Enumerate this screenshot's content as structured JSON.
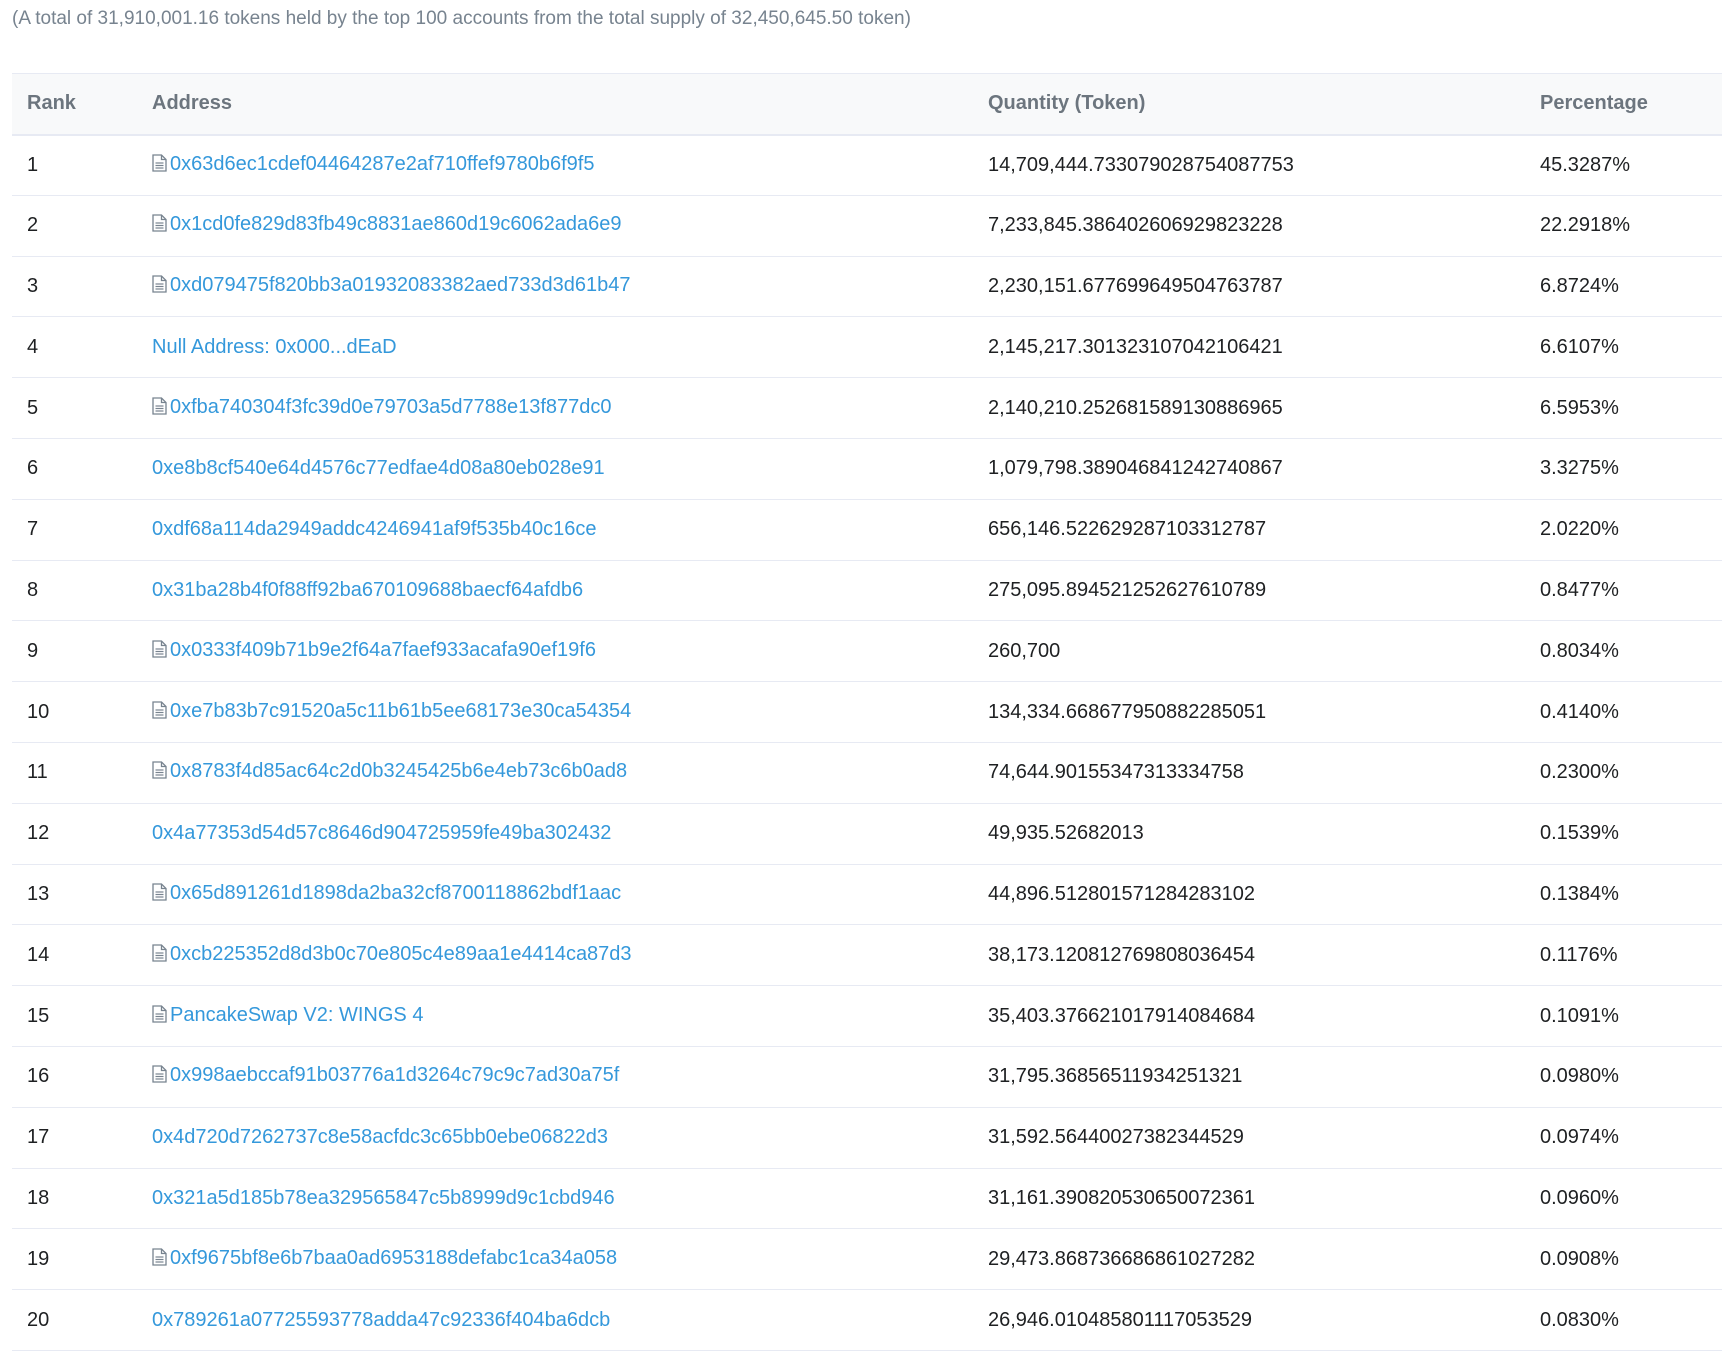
{
  "summary": "(A total of 31,910,001.16 tokens held by the top 100 accounts from the total supply of 32,450,645.50 token)",
  "columns": {
    "rank": "Rank",
    "address": "Address",
    "quantity": "Quantity (Token)",
    "percentage": "Percentage"
  },
  "rows": [
    {
      "rank": "1",
      "address": "0x63d6ec1cdef04464287e2af710ffef9780b6f9f5",
      "contract": true,
      "quantity": "14,709,444.733079028754087753",
      "percentage": "45.3287%"
    },
    {
      "rank": "2",
      "address": "0x1cd0fe829d83fb49c8831ae860d19c6062ada6e9",
      "contract": true,
      "quantity": "7,233,845.386402606929823228",
      "percentage": "22.2918%"
    },
    {
      "rank": "3",
      "address": "0xd079475f820bb3a01932083382aed733d3d61b47",
      "contract": true,
      "quantity": "2,230,151.677699649504763787",
      "percentage": "6.8724%"
    },
    {
      "rank": "4",
      "address": "Null Address: 0x000...dEaD",
      "contract": false,
      "quantity": "2,145,217.301323107042106421",
      "percentage": "6.6107%"
    },
    {
      "rank": "5",
      "address": "0xfba740304f3fc39d0e79703a5d7788e13f877dc0",
      "contract": true,
      "quantity": "2,140,210.252681589130886965",
      "percentage": "6.5953%"
    },
    {
      "rank": "6",
      "address": "0xe8b8cf540e64d4576c77edfae4d08a80eb028e91",
      "contract": false,
      "quantity": "1,079,798.389046841242740867",
      "percentage": "3.3275%"
    },
    {
      "rank": "7",
      "address": "0xdf68a114da2949addc4246941af9f535b40c16ce",
      "contract": false,
      "quantity": "656,146.522629287103312787",
      "percentage": "2.0220%"
    },
    {
      "rank": "8",
      "address": "0x31ba28b4f0f88ff92ba670109688baecf64afdb6",
      "contract": false,
      "quantity": "275,095.894521252627610789",
      "percentage": "0.8477%"
    },
    {
      "rank": "9",
      "address": "0x0333f409b71b9e2f64a7faef933acafa90ef19f6",
      "contract": true,
      "quantity": "260,700",
      "percentage": "0.8034%"
    },
    {
      "rank": "10",
      "address": "0xe7b83b7c91520a5c11b61b5ee68173e30ca54354",
      "contract": true,
      "quantity": "134,334.668677950882285051",
      "percentage": "0.4140%"
    },
    {
      "rank": "11",
      "address": "0x8783f4d85ac64c2d0b3245425b6e4eb73c6b0ad8",
      "contract": true,
      "quantity": "74,644.90155347313334758",
      "percentage": "0.2300%"
    },
    {
      "rank": "12",
      "address": "0x4a77353d54d57c8646d904725959fe49ba302432",
      "contract": false,
      "quantity": "49,935.52682013",
      "percentage": "0.1539%"
    },
    {
      "rank": "13",
      "address": "0x65d891261d1898da2ba32cf8700118862bdf1aac",
      "contract": true,
      "quantity": "44,896.512801571284283102",
      "percentage": "0.1384%"
    },
    {
      "rank": "14",
      "address": "0xcb225352d8d3b0c70e805c4e89aa1e4414ca87d3",
      "contract": true,
      "quantity": "38,173.120812769808036454",
      "percentage": "0.1176%"
    },
    {
      "rank": "15",
      "address": "PancakeSwap V2: WINGS 4",
      "contract": true,
      "quantity": "35,403.376621017914084684",
      "percentage": "0.1091%"
    },
    {
      "rank": "16",
      "address": "0x998aebccaf91b03776a1d3264c79c9c7ad30a75f",
      "contract": true,
      "quantity": "31,795.36856511934251321",
      "percentage": "0.0980%"
    },
    {
      "rank": "17",
      "address": "0x4d720d7262737c8e58acfdc3c65bb0ebe06822d3",
      "contract": false,
      "quantity": "31,592.56440027382344529",
      "percentage": "0.0974%"
    },
    {
      "rank": "18",
      "address": "0x321a5d185b78ea329565847c5b8999d9c1cbd946",
      "contract": false,
      "quantity": "31,161.390820530650072361",
      "percentage": "0.0960%"
    },
    {
      "rank": "19",
      "address": "0xf9675bf8e6b7baa0ad6953188defabc1ca34a058",
      "contract": true,
      "quantity": "29,473.868736686861027282",
      "percentage": "0.0908%"
    },
    {
      "rank": "20",
      "address": "0x789261a07725593778adda47c92336f404ba6dcb",
      "contract": false,
      "quantity": "26,946.010485801117053529",
      "percentage": "0.0830%"
    }
  ],
  "icons": {
    "contract": "contract-file-icon"
  },
  "colors": {
    "link": "#3498db",
    "muted": "#77838f",
    "header_text": "#6c757e",
    "border": "#e7eaf3"
  }
}
